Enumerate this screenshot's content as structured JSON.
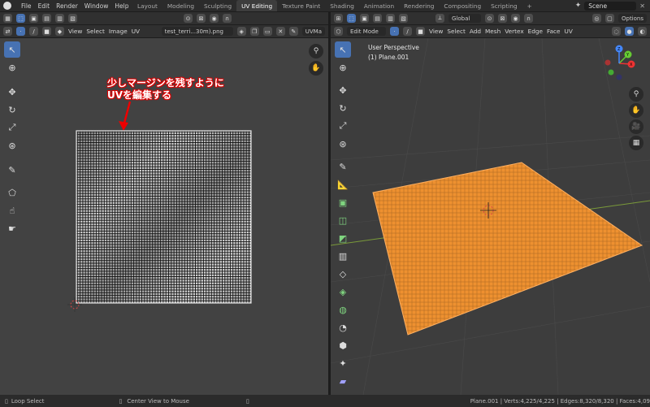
{
  "menu": {
    "items": [
      "File",
      "Edit",
      "Render",
      "Window",
      "Help"
    ]
  },
  "workspace_tabs": [
    {
      "label": "Layout",
      "active": false
    },
    {
      "label": "Modeling",
      "active": false
    },
    {
      "label": "Sculpting",
      "active": false
    },
    {
      "label": "UV Editing",
      "active": true
    },
    {
      "label": "Texture Paint",
      "active": false
    },
    {
      "label": "Shading",
      "active": false
    },
    {
      "label": "Animation",
      "active": false
    },
    {
      "label": "Rendering",
      "active": false
    },
    {
      "label": "Compositing",
      "active": false
    },
    {
      "label": "Scripting",
      "active": false
    }
  ],
  "add_tab": "+",
  "scene": {
    "value": "Scene"
  },
  "uv_editor": {
    "header_menu": [
      "View",
      "Select",
      "Image",
      "UV"
    ],
    "image_name": "test_terri...30m).png",
    "uvmap": "UVMa",
    "annotation_line1": "少しマージンを残すように",
    "annotation_line2": "UVを編集する"
  },
  "viewport": {
    "orientation_label": "Global",
    "options_label": "Options",
    "mode": "Edit Mode",
    "header_menu": [
      "View",
      "Select",
      "Add",
      "Mesh",
      "Vertex",
      "Edge",
      "Face",
      "UV"
    ],
    "perspective_text": "User Perspective",
    "object_text": "(1) Plane.001",
    "gizmo_axes": [
      "X",
      "Y",
      "Z"
    ]
  },
  "status_bar": {
    "left_action": "Loop Select",
    "middle_action": "Center View to Mouse",
    "stats": "Plane.001 | Verts:4,225/4,225 | Edges:8,320/8,320 | Faces:4,09"
  }
}
